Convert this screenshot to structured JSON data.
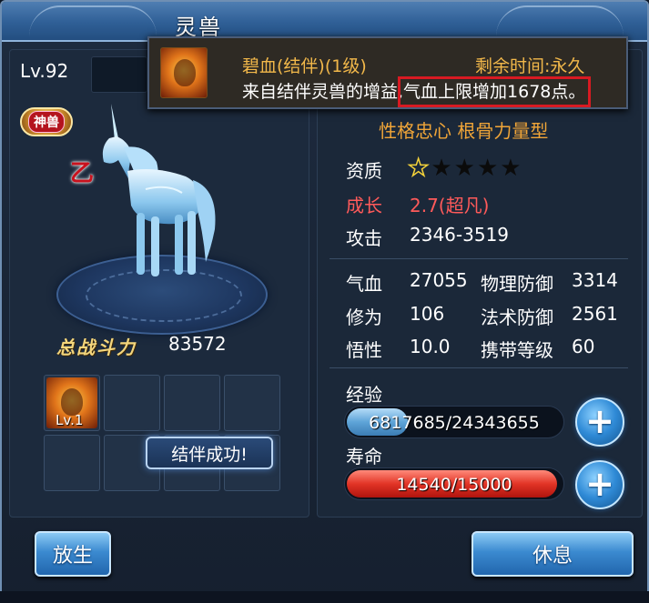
{
  "window": {
    "title": "灵兽"
  },
  "pet": {
    "level": "Lv.92",
    "badge": "神兽",
    "rank_mark": "乙",
    "power_label": "总战斗力",
    "power_value": "83572"
  },
  "slots": [
    {
      "filled": true,
      "level": "Lv.1"
    },
    {
      "filled": false
    },
    {
      "filled": false
    },
    {
      "filled": false
    },
    {
      "filled": false
    },
    {
      "filled": false
    },
    {
      "filled": false
    },
    {
      "filled": false
    }
  ],
  "toast": {
    "text": "结伴成功!"
  },
  "personality": "性格忠心 根骨力量型",
  "stats": {
    "aptitude_label": "资质",
    "aptitude_stars": 1,
    "aptitude_max": 5,
    "growth_label": "成长",
    "growth_value": "2.7(超凡)",
    "attack_label": "攻击",
    "attack_value": "2346-3519",
    "hp_label": "气血",
    "hp_value": "27055",
    "phys_def_label": "物理防御",
    "phys_def_value": "3314",
    "cultivation_label": "修为",
    "cultivation_value": "106",
    "magic_def_label": "法术防御",
    "magic_def_value": "2561",
    "savvy_label": "悟性",
    "savvy_value": "10.0",
    "carry_level_label": "携带等级",
    "carry_level_value": "60"
  },
  "experience": {
    "label": "经验",
    "text": "6817685/24343655",
    "current": 6817685,
    "max": 24343655
  },
  "lifespan": {
    "label": "寿命",
    "text": "14540/15000",
    "current": 14540,
    "max": 15000
  },
  "buttons": {
    "release": "放生",
    "rest": "休息"
  },
  "tooltip": {
    "name": "碧血(结伴)(1级)",
    "time": "剩余时间:永久",
    "desc_prefix": "来自结伴灵兽的增益,",
    "desc_highlight": "气血上限增加1678点。"
  },
  "colors": {
    "accent_orange": "#f0a538",
    "growth_red": "#ff5a5a",
    "exp_blue": "#5ea4d8",
    "life_red": "#e23426",
    "highlight_red": "#d81a22"
  }
}
